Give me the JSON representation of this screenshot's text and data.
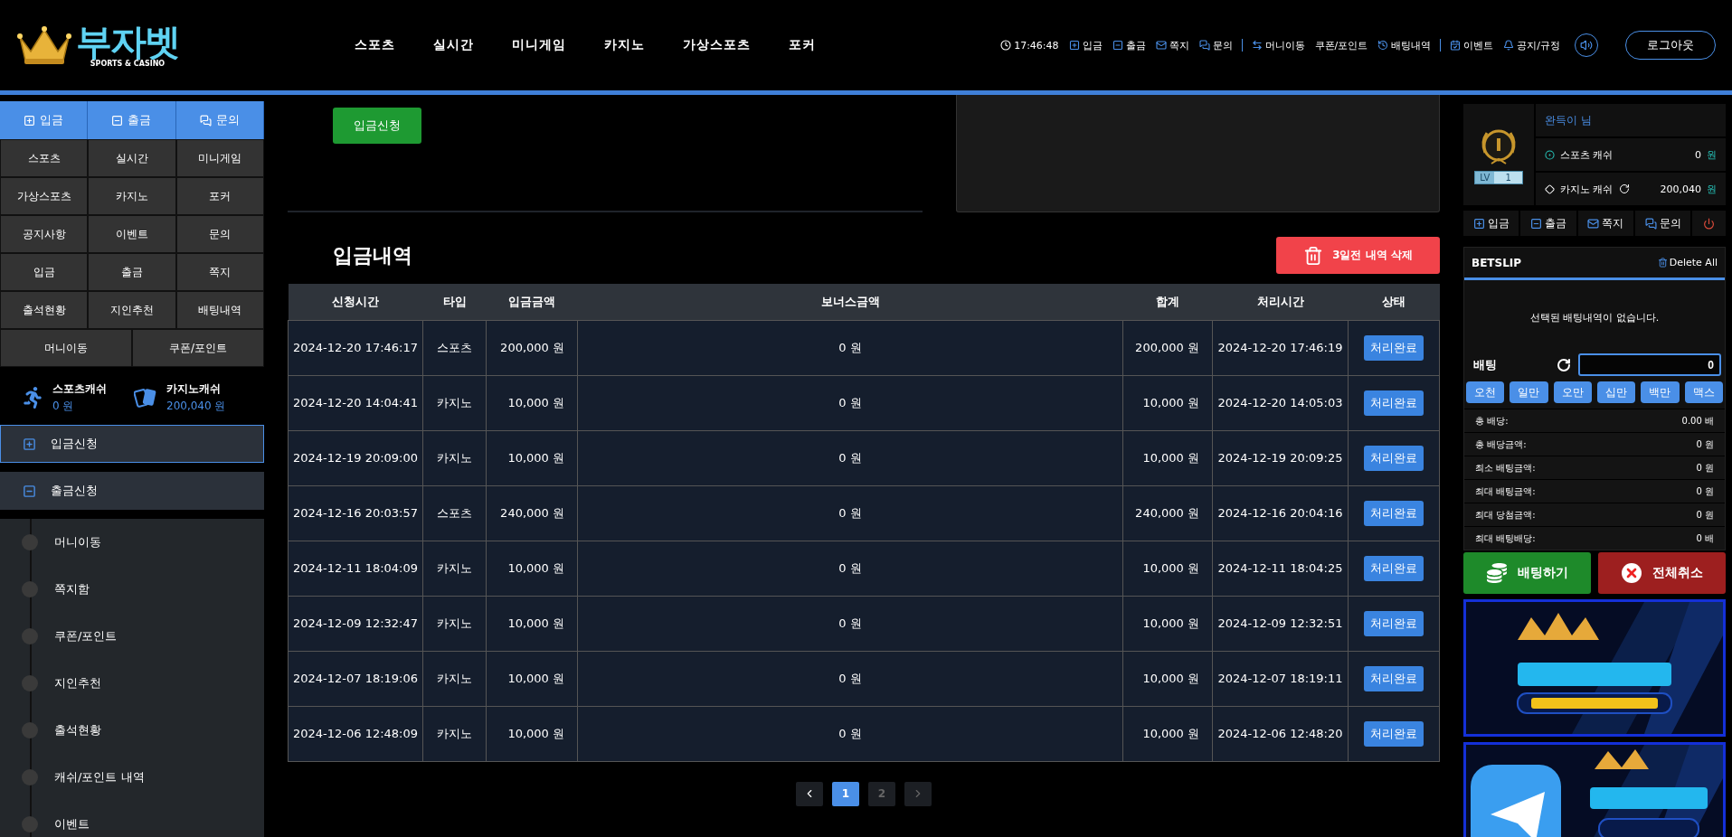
{
  "header": {
    "logo": {
      "title": "부자벳",
      "subtitle": "SPORTS & CASINO"
    },
    "nav": [
      "스포츠",
      "실시간",
      "미니게임",
      "카지노",
      "가상스포츠",
      "포커"
    ],
    "utility_groups": [
      {
        "items": [
          "17:46:48",
          "입금",
          "출금",
          "쪽지",
          "문의"
        ]
      },
      {
        "items": [
          "머니이동",
          "쿠폰/포인트",
          "배팅내역"
        ]
      },
      {
        "items": [
          "이벤트",
          "공지/규정"
        ]
      }
    ],
    "logout": "로그아웃"
  },
  "sidebar": {
    "quick": [
      "입금",
      "출금",
      "문의"
    ],
    "grid": [
      "스포츠",
      "실시간",
      "미니게임",
      "가상스포츠",
      "카지노",
      "포커",
      "공지사항",
      "이벤트",
      "문의",
      "입금",
      "출금",
      "쪽지",
      "출석현황",
      "지인추천",
      "배팅내역"
    ],
    "wide": [
      "머니이동",
      "쿠폰/포인트"
    ],
    "cash": [
      {
        "label": "스포츠캐쉬",
        "value": "0 원"
      },
      {
        "label": "카지노캐쉬",
        "value": "200,040 원"
      }
    ],
    "accordion": [
      {
        "label": "입금신청",
        "selected": true
      },
      {
        "label": "출금신청",
        "selected": false
      }
    ],
    "submenu": [
      "머니이동",
      "쪽지함",
      "쿠폰/포인트",
      "지인추천",
      "출석현황",
      "캐쉬/포인트 내역",
      "이벤트"
    ]
  },
  "main": {
    "request_button": "입금신청",
    "title": "입금내역",
    "delete_button": "3일전 내역 삭제",
    "columns": [
      "신청시간",
      "타입",
      "입금금액",
      "보너스금액",
      "합계",
      "처리시간",
      "상태"
    ],
    "rows": [
      {
        "requested": "2024-12-20 17:46:17",
        "type": "스포츠",
        "amount": "200,000 원",
        "bonus": "0 원",
        "total": "200,000 원",
        "processed": "2024-12-20 17:46:19",
        "status": "처리완료"
      },
      {
        "requested": "2024-12-20 14:04:41",
        "type": "카지노",
        "amount": "10,000 원",
        "bonus": "0 원",
        "total": "10,000 원",
        "processed": "2024-12-20 14:05:03",
        "status": "처리완료"
      },
      {
        "requested": "2024-12-19 20:09:00",
        "type": "카지노",
        "amount": "10,000 원",
        "bonus": "0 원",
        "total": "10,000 원",
        "processed": "2024-12-19 20:09:25",
        "status": "처리완료"
      },
      {
        "requested": "2024-12-16 20:03:57",
        "type": "스포츠",
        "amount": "240,000 원",
        "bonus": "0 원",
        "total": "240,000 원",
        "processed": "2024-12-16 20:04:16",
        "status": "처리완료"
      },
      {
        "requested": "2024-12-11 18:04:09",
        "type": "카지노",
        "amount": "10,000 원",
        "bonus": "0 원",
        "total": "10,000 원",
        "processed": "2024-12-11 18:04:25",
        "status": "처리완료"
      },
      {
        "requested": "2024-12-09 12:32:47",
        "type": "카지노",
        "amount": "10,000 원",
        "bonus": "0 원",
        "total": "10,000 원",
        "processed": "2024-12-09 12:32:51",
        "status": "처리완료"
      },
      {
        "requested": "2024-12-07 18:19:06",
        "type": "카지노",
        "amount": "10,000 원",
        "bonus": "0 원",
        "total": "10,000 원",
        "processed": "2024-12-07 18:19:11",
        "status": "처리완료"
      },
      {
        "requested": "2024-12-06 12:48:09",
        "type": "카지노",
        "amount": "10,000 원",
        "bonus": "0 원",
        "total": "10,000 원",
        "processed": "2024-12-06 12:48:20",
        "status": "처리완료"
      }
    ],
    "pages": [
      {
        "label": "1",
        "selected": true
      },
      {
        "label": "2",
        "selected": false
      }
    ]
  },
  "right": {
    "profile": {
      "name": "완득이 님",
      "level_label": "LV",
      "level": "1"
    },
    "balances": [
      {
        "label": "스포츠 캐쉬",
        "amount": "0",
        "unit": "원"
      },
      {
        "label": "카지노 캐쉬",
        "amount": "200,040",
        "unit": "원"
      }
    ],
    "quick": [
      "입금",
      "출금",
      "쪽지",
      "문의"
    ],
    "betslip": {
      "title": "BETSLIP",
      "delete": "Delete All",
      "empty": "선택된 배팅내역이 없습니다.",
      "stake_label": "배팅",
      "stake": "0",
      "chips": [
        "오천",
        "일만",
        "오만",
        "십만",
        "백만",
        "맥스"
      ],
      "summary": [
        {
          "label": "총 배당:",
          "value": "0.00 배"
        },
        {
          "label": "총 배당금액:",
          "value": "0 원"
        },
        {
          "label": "최소 배팅금액:",
          "value": "0 원"
        },
        {
          "label": "최대 배팅금액:",
          "value": "0 원"
        },
        {
          "label": "최대 당첨금액:",
          "value": "0 원"
        },
        {
          "label": "최대 배팅배당:",
          "value": "0 배"
        }
      ],
      "bet_button": "배팅하기",
      "cancel_button": "전체취소"
    },
    "banners": [
      {
        "kind": "picture"
      },
      {
        "kind": "picture"
      }
    ]
  }
}
